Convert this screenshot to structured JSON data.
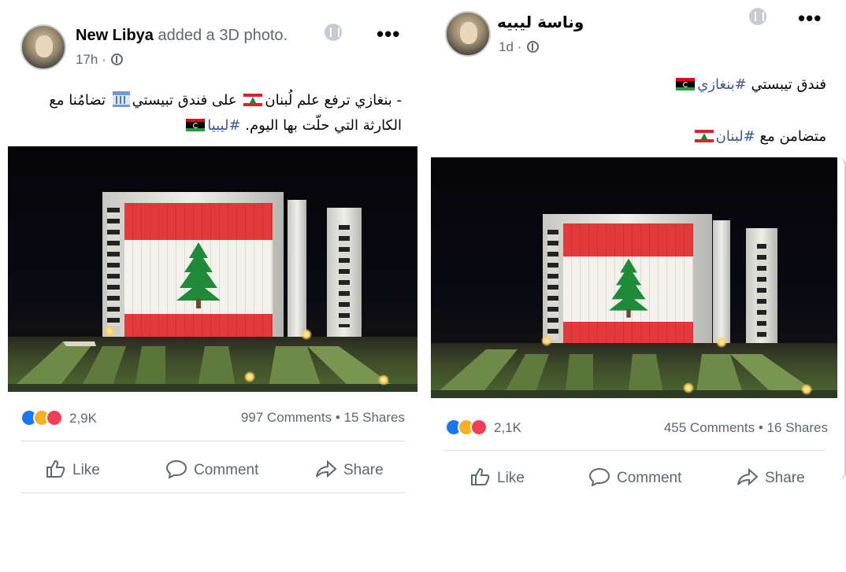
{
  "left_post": {
    "author": "New Libya",
    "action": " added a 3D photo.",
    "time": "17h · ",
    "more_icon": "•••",
    "text_line1_a": "- بنغازي ترفع علم لُبنان",
    "text_line1_b": " على فندق تبيستي",
    "text_line1_c": " تضامُنا مع",
    "text_line2_a": "الكارثة التي حلّت بها اليوم. ",
    "text_line2_hashtag": "#ليبيا",
    "reaction_count": "2,9K",
    "comments_shares": "997 Comments • 15 Shares",
    "like_label": "Like",
    "comment_label": "Comment",
    "share_label": "Share"
  },
  "right_post": {
    "author": "وناسة ليبيه",
    "time": "1d · ",
    "more_icon": "•••",
    "text_line1_a": "فندق تيبستي ",
    "text_line1_hashtag": "#بنغازي",
    "text_line2_a": "متضامن مع ",
    "text_line2_hashtag": "#لبنان",
    "reaction_count": "2,1K",
    "comments_shares": "455 Comments • 16 Shares",
    "like_label": "Like",
    "comment_label": "Comment",
    "share_label": "Share"
  },
  "colors": {
    "hashtag": "#385898",
    "like_blue": "#1877f2",
    "haha_yellow": "#f7b125",
    "love_red": "#f33e58",
    "secondary_text": "#606770"
  },
  "icons": [
    "globe-icon",
    "info-badge-icon",
    "more-icon",
    "lebanon-flag-icon",
    "libya-flag-icon",
    "bank-icon",
    "like-icon",
    "comment-icon",
    "share-icon"
  ]
}
